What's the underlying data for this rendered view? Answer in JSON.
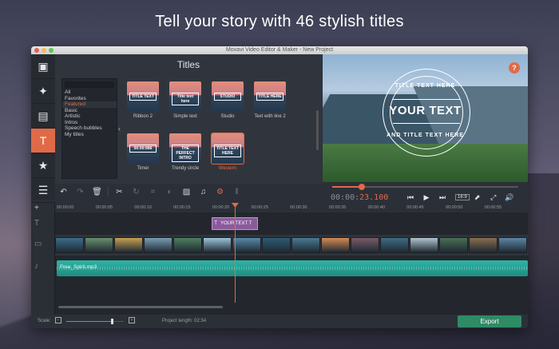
{
  "headline": "Tell your story with 46 stylish titles",
  "window": {
    "title": "Movavi Video Editor & Maker - New Project"
  },
  "rail": {
    "items": [
      {
        "name": "import-media-icon",
        "glyph": "▣"
      },
      {
        "name": "magic-wand-icon",
        "glyph": "✦"
      },
      {
        "name": "filters-icon",
        "glyph": "▤"
      },
      {
        "name": "titles-icon",
        "glyph": "T"
      },
      {
        "name": "stickers-icon",
        "glyph": "★"
      },
      {
        "name": "more-tools-icon",
        "glyph": "☰"
      }
    ],
    "active_index": 3
  },
  "titles_panel": {
    "heading": "Titles",
    "categories": [
      "All",
      "Favorites",
      "Featured",
      "Basic",
      "Artistic",
      "Intros",
      "Speech bubbles",
      "My titles"
    ],
    "selected_category": "Featured",
    "items": [
      {
        "label": "Ribbon 2",
        "preview": "TITLE TEXT",
        "selected": false
      },
      {
        "label": "Simple text",
        "preview": "Title text here",
        "selected": false
      },
      {
        "label": "Studio",
        "preview": "STUDIO",
        "selected": false
      },
      {
        "label": "Text with line 2",
        "preview": "TITLE HERE",
        "selected": false
      },
      {
        "label": "Timer",
        "preview": "00:00:986",
        "selected": false
      },
      {
        "label": "Trendy circle",
        "preview": "THE PERFECT INTRO",
        "selected": false
      },
      {
        "label": "Western",
        "preview": "TITLE TEXT HERE",
        "selected": true
      }
    ]
  },
  "preview": {
    "top_text": "TITLE TEXT HERE",
    "main_text": "YOUR TEXT",
    "bottom_text": "AND TITLE TEXT HERE",
    "help_glyph": "?",
    "progress_fraction": 0.16
  },
  "transport": {
    "timecode_dim": "00:00:",
    "timecode_hi": "23.100",
    "aspect": "16:9"
  },
  "timeline": {
    "ticks": [
      "00:00:00",
      "00:00:05",
      "00:00:10",
      "00:00:15",
      "00:00:20",
      "00:00:25",
      "00:00:30",
      "00:00:35",
      "00:00:40",
      "00:00:45",
      "00:00:50",
      "00:00:55"
    ],
    "title_clip": "YOUR TEXT T",
    "audio_clip": "Free_Spirit.mp3",
    "video_clip_colors": [
      "#3d6d8a",
      "#6a8f6e",
      "#c9a050",
      "#7a9cb5",
      "#4f7f5f",
      "#9cc3d8",
      "#5a89a8",
      "#2e5b73",
      "#4a7a94",
      "#d48a54",
      "#7a5a68",
      "#3e6c86",
      "#b0c4cf",
      "#4a6f55",
      "#8a6d4e",
      "#5d86a6"
    ]
  },
  "bottombar": {
    "scale_label": "Scale:",
    "scale_fraction": 0.78,
    "project_length": "Project length:  02:34",
    "export_label": "Export"
  },
  "colors": {
    "accent": "#e06a47",
    "export": "#2f8a66",
    "audio": "#2fb3a3",
    "title_clip": "#8a5b9b"
  }
}
